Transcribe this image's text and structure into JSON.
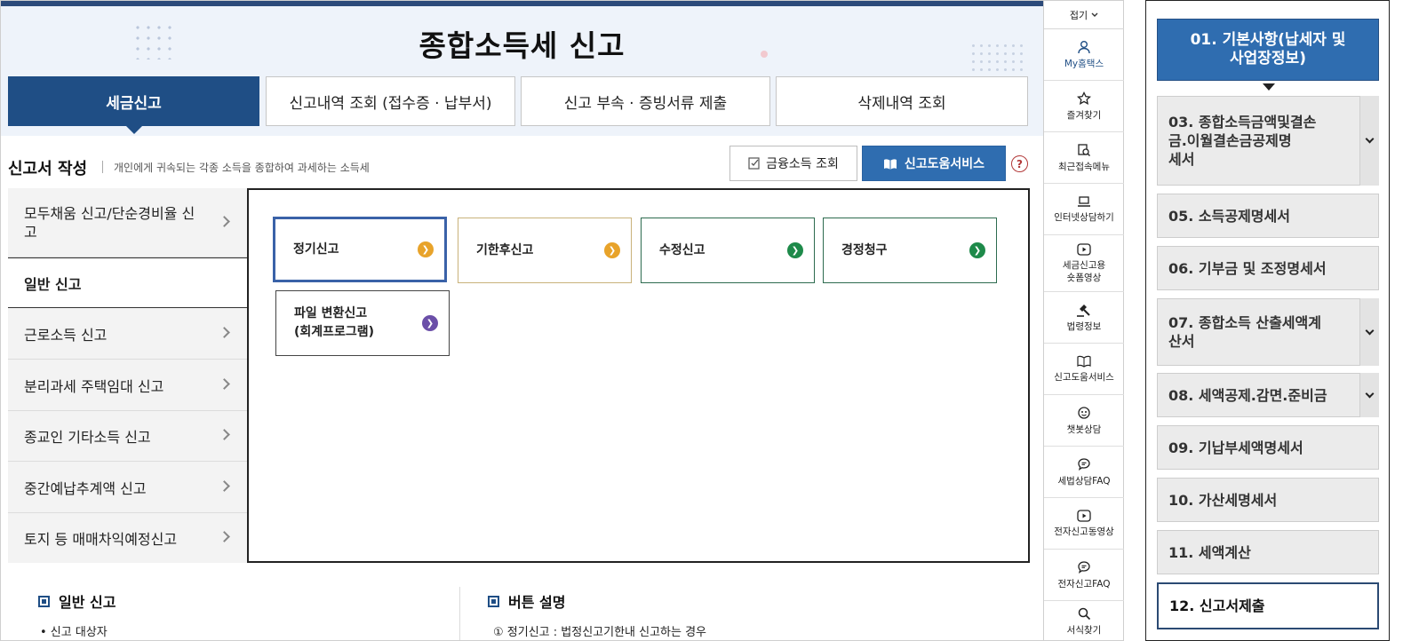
{
  "page": {
    "title": "종합소득세 신고",
    "tabs": [
      {
        "label": "세금신고",
        "active": true
      },
      {
        "label": "신고내역 조회 (접수증 · 납부서)",
        "active": false
      },
      {
        "label": "신고 부속 · 증빙서류 제출",
        "active": false
      },
      {
        "label": "삭제내역 조회",
        "active": false
      }
    ]
  },
  "form_header": {
    "title": "신고서 작성",
    "description": "개인에게 귀속되는 각종 소득을 종합하여 과세하는 소득세",
    "financial_income_button": "금융소득 조회",
    "help_service_button": "신고도움서비스",
    "help_icon_text": "?"
  },
  "left_menu": {
    "items": [
      {
        "label": "모두채움 신고/단순경비율 신고",
        "active": false
      },
      {
        "label": "일반 신고",
        "active": true
      },
      {
        "label": "근로소득 신고",
        "active": false
      },
      {
        "label": "분리과세 주택임대 신고",
        "active": false
      },
      {
        "label": "종교인 기타소득 신고",
        "active": false
      },
      {
        "label": "중간예납추계액 신고",
        "active": false
      },
      {
        "label": "토지 등 매매차익예정신고",
        "active": false
      }
    ]
  },
  "filing_options": {
    "cards": [
      {
        "label": "정기신고",
        "color": "#e8a32a",
        "border": "#3a62a8"
      },
      {
        "label": "기한후신고",
        "color": "#e8a32a",
        "border": "#c9b27a"
      },
      {
        "label": "수정신고",
        "color": "#1e8a4a",
        "border": "#2d6b4f"
      },
      {
        "label": "경정청구",
        "color": "#1e8a4a",
        "border": "#2d6b4f"
      },
      {
        "label": "파일 변환신고\n(회계프로그램)",
        "color": "#6b4fa8",
        "border": "#444444"
      }
    ]
  },
  "bottom": {
    "left_title": "일반 신고",
    "left_line": "• 신고 대상자",
    "right_title": "버튼 설명",
    "right_line": "① 정기신고 : 법정신고기한내 신고하는 경우"
  },
  "quick_bar": {
    "fold_label": "접기",
    "items": [
      {
        "label": "My홈택스",
        "icon": "person-icon"
      },
      {
        "label": "즐겨찾기",
        "icon": "star-icon"
      },
      {
        "label": "최근접속메뉴",
        "icon": "recent-search-icon"
      },
      {
        "label": "인터넷상담하기",
        "icon": "laptop-icon"
      },
      {
        "label": "세금신고용\n숏폼영상",
        "icon": "play-icon"
      },
      {
        "label": "법령정보",
        "icon": "gavel-icon"
      },
      {
        "label": "신고도움서비스",
        "icon": "book-icon"
      },
      {
        "label": "챗봇상담",
        "icon": "chatbot-icon"
      },
      {
        "label": "세법상담FAQ",
        "icon": "chat-icon"
      },
      {
        "label": "전자신고동영상",
        "icon": "play-icon"
      },
      {
        "label": "전자신고FAQ",
        "icon": "chat-icon"
      },
      {
        "label": "서식찾기",
        "icon": "search-icon"
      }
    ]
  },
  "steps": {
    "items": [
      {
        "label": "01. 기본사항(납세자 및\n사업장정보)",
        "state": "active",
        "dropdown": false
      },
      {
        "label": "03. 종합소득금액및결손\n금.이월결손금공제명\n세서",
        "state": "normal",
        "dropdown": true
      },
      {
        "label": "05. 소득공제명세서",
        "state": "normal",
        "dropdown": false
      },
      {
        "label": "06. 기부금 및 조정명세서",
        "state": "normal",
        "dropdown": false
      },
      {
        "label": "07. 종합소득 산출세액계\n산서",
        "state": "normal",
        "dropdown": true
      },
      {
        "label": "08. 세액공제.감면.준비금",
        "state": "normal",
        "dropdown": true
      },
      {
        "label": "09. 기납부세액명세서",
        "state": "normal",
        "dropdown": false
      },
      {
        "label": "10. 가산세명세서",
        "state": "normal",
        "dropdown": false
      },
      {
        "label": "11. 세액계산",
        "state": "normal",
        "dropdown": false
      },
      {
        "label": "12. 신고서제출",
        "state": "current",
        "dropdown": false
      }
    ]
  }
}
